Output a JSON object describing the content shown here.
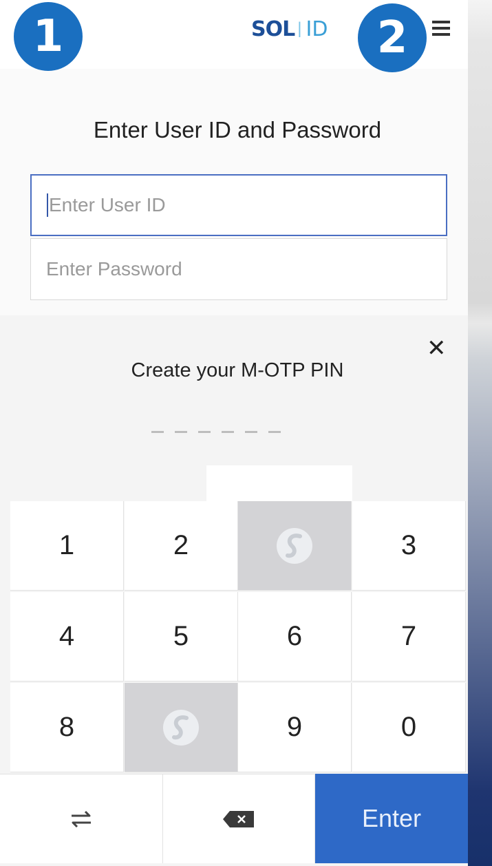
{
  "badges": {
    "first": "1",
    "second": "2"
  },
  "header": {
    "logo_sol": "SOL",
    "logo_separator": "|",
    "logo_id": "ID"
  },
  "login": {
    "title": "Enter User ID and Password",
    "user_id_placeholder": "Enter User ID",
    "password_placeholder": "Enter Password"
  },
  "pin_pad": {
    "title": "Create your M-OTP PIN",
    "pin_length_slots": 6,
    "rows": [
      [
        "1",
        "2",
        "",
        "3"
      ],
      [
        "4",
        "5",
        "6",
        "7"
      ],
      [
        "8",
        "",
        "9",
        "0"
      ]
    ],
    "enter_label": "Enter"
  },
  "colors": {
    "badge": "#1a6fc0",
    "enter_key": "#2e69c7",
    "blank_key": "#d3d3d6",
    "logo_dark": "#1d4f98",
    "logo_light": "#3a9fd6"
  },
  "icons": {
    "menu": "hamburger-icon",
    "close": "close-icon",
    "swap": "swap-arrows-icon",
    "backspace": "backspace-icon",
    "blank_key": "bank-logo-icon"
  }
}
